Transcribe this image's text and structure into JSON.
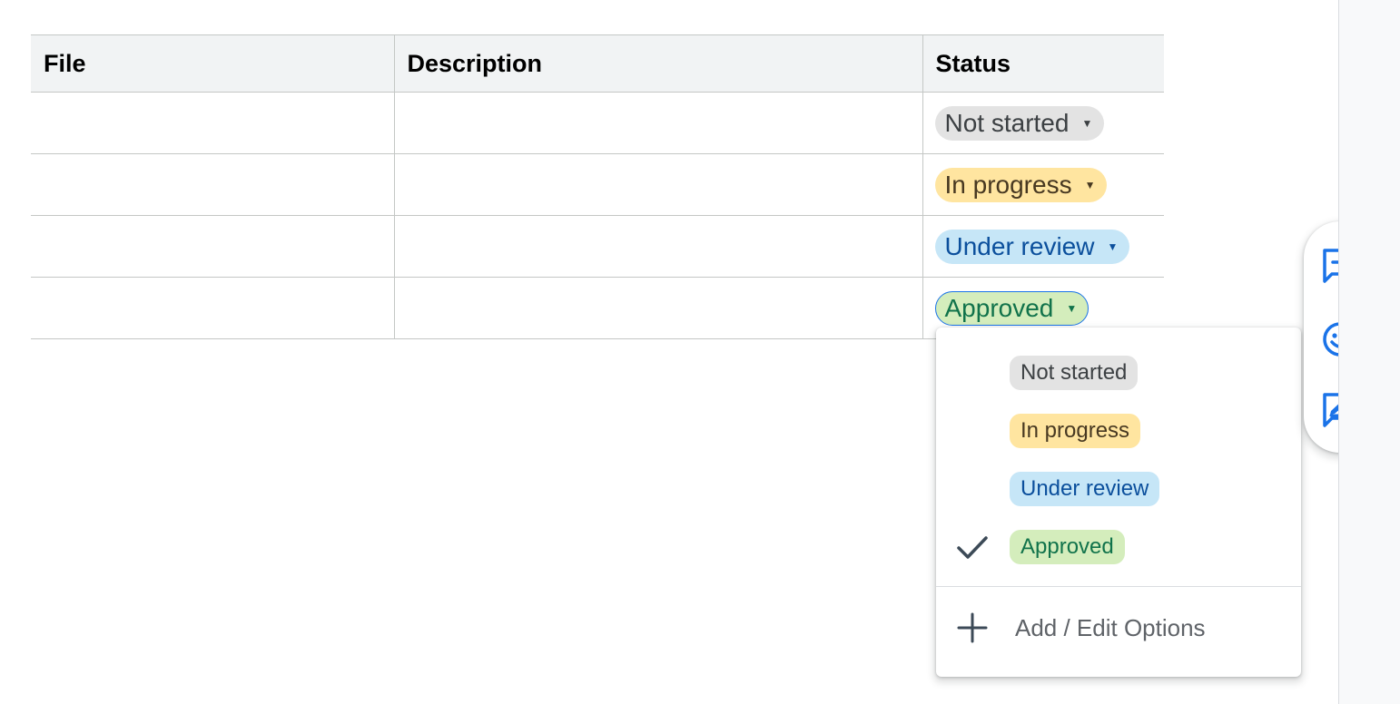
{
  "table": {
    "headers": {
      "file": "File",
      "description": "Description",
      "status": "Status"
    },
    "rows": [
      {
        "status": "Not started"
      },
      {
        "status": "In progress"
      },
      {
        "status": "Under review"
      },
      {
        "status": "Approved"
      }
    ]
  },
  "dropdown": {
    "options": [
      "Not started",
      "In progress",
      "Under review",
      "Approved"
    ],
    "selected": "Approved",
    "add_edit_label": "Add / Edit Options"
  },
  "side_toolbar": {
    "icons": [
      "add-comment-icon",
      "emoji-reaction-icon",
      "suggest-edits-icon"
    ],
    "accent_color": "#1a73e8"
  },
  "colors": {
    "not_started_bg": "#e3e3e3",
    "in_progress_bg": "#ffe5a0",
    "under_review_bg": "#c6e6f7",
    "approved_bg": "#d4edbc"
  }
}
